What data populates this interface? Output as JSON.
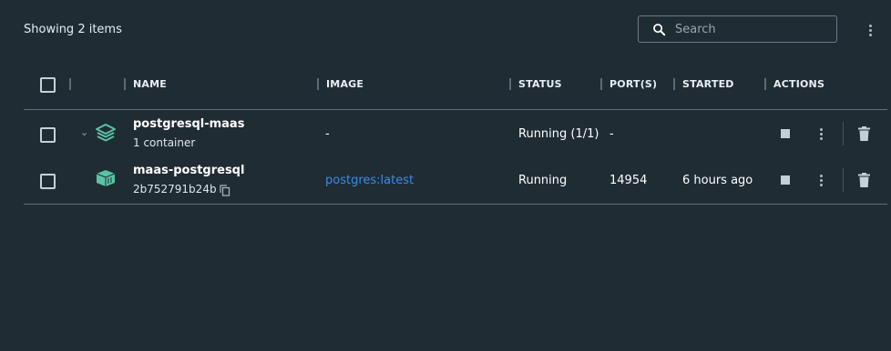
{
  "toolbar": {
    "count_label": "Showing 2 items",
    "search_placeholder": "Search"
  },
  "table": {
    "headers": {
      "name": "NAME",
      "image": "IMAGE",
      "status": "STATUS",
      "ports": "PORT(S)",
      "started": "STARTED",
      "actions": "ACTIONS"
    },
    "rows": [
      {
        "name": "postgresql-maas",
        "subtitle": "1 container",
        "image": "-",
        "status": "Running (1/1)",
        "ports": "-",
        "started": "",
        "icon": "stack-icon",
        "expanded": true
      },
      {
        "name": "maas-postgresql",
        "subtitle": "2b752791b24b",
        "image": "postgres:latest",
        "status": "Running",
        "ports": "14954",
        "started": "6 hours ago",
        "icon": "container-icon"
      }
    ]
  },
  "colors": {
    "background": "#202c33",
    "accent_icon": "#58c4a4",
    "link": "#3b8beb"
  }
}
